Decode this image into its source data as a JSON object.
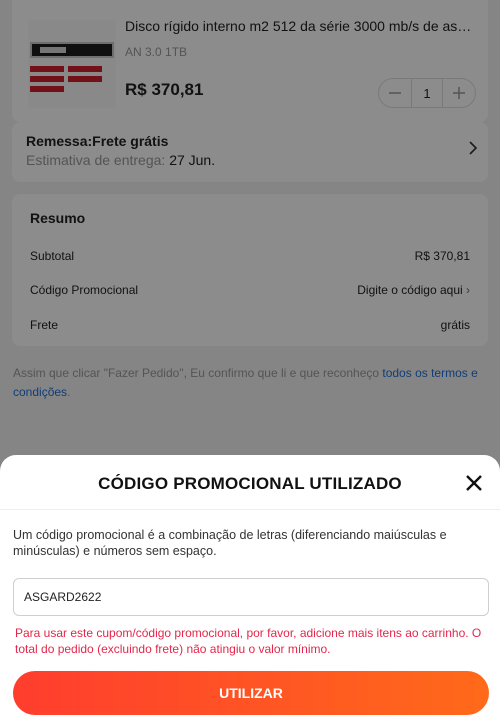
{
  "product": {
    "title": "Disco rígido interno m2 512 da série 3000 mb/s de asg...",
    "variant": "AN 3.0 1TB",
    "price": "R$ 370,81",
    "quantity": "1",
    "minus_icon": "minus-icon",
    "plus_icon": "plus-icon"
  },
  "shipping": {
    "title": "Remessa:Frete grátis",
    "estimate_label": "Estimativa de entrega:",
    "estimate_date": "27 Jun."
  },
  "summary": {
    "title": "Resumo",
    "rows": [
      {
        "label": "Subtotal",
        "value": "R$ 370,81"
      },
      {
        "label": "Código Promocional",
        "value": "Digite o código aqui"
      },
      {
        "label": "Frete",
        "value": "grátis"
      }
    ]
  },
  "terms": {
    "text": "Assim que clicar \"Fazer Pedido\", Eu confirmo que li e que reconheço ",
    "link": "todos os termos e condições",
    "end": "."
  },
  "modal": {
    "title": "CÓDIGO PROMOCIONAL UTILIZADO",
    "description": "Um código promocional é a combinação de letras (diferenciando maiúsculas e minúsculas) e números sem espaço.",
    "input_value": "ASGARD2622",
    "error": "Para usar este cupom/código promocional, por favor, adicione mais itens ao carrinho. O total do pedido (excluindo frete) não atingiu o valor mínimo.",
    "button_label": "UTILIZAR"
  },
  "colors": {
    "accent": "#ff4a24",
    "error": "#e5264a",
    "link": "#1e6fd9"
  }
}
